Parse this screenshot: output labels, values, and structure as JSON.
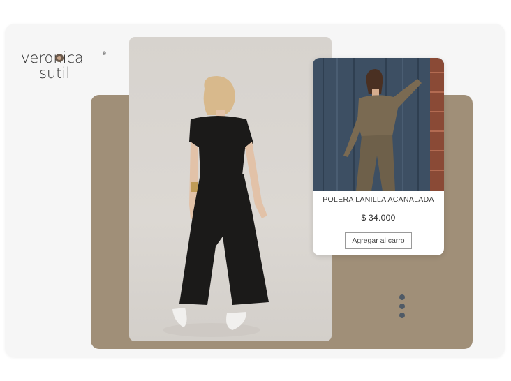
{
  "brand": {
    "logo_line1": "veronica",
    "logo_line2": "sutil",
    "logo_mark": "®"
  },
  "product": {
    "name": "POLERA LANILLA ACANALADA",
    "price": "$ 34.000",
    "add_to_cart_label": "Agregar al carro"
  },
  "icons": {
    "more": "more-vertical-icon"
  },
  "colors": {
    "panel": "#a08f78",
    "accent": "#cf9a76",
    "kebab": "#4f5a66"
  }
}
